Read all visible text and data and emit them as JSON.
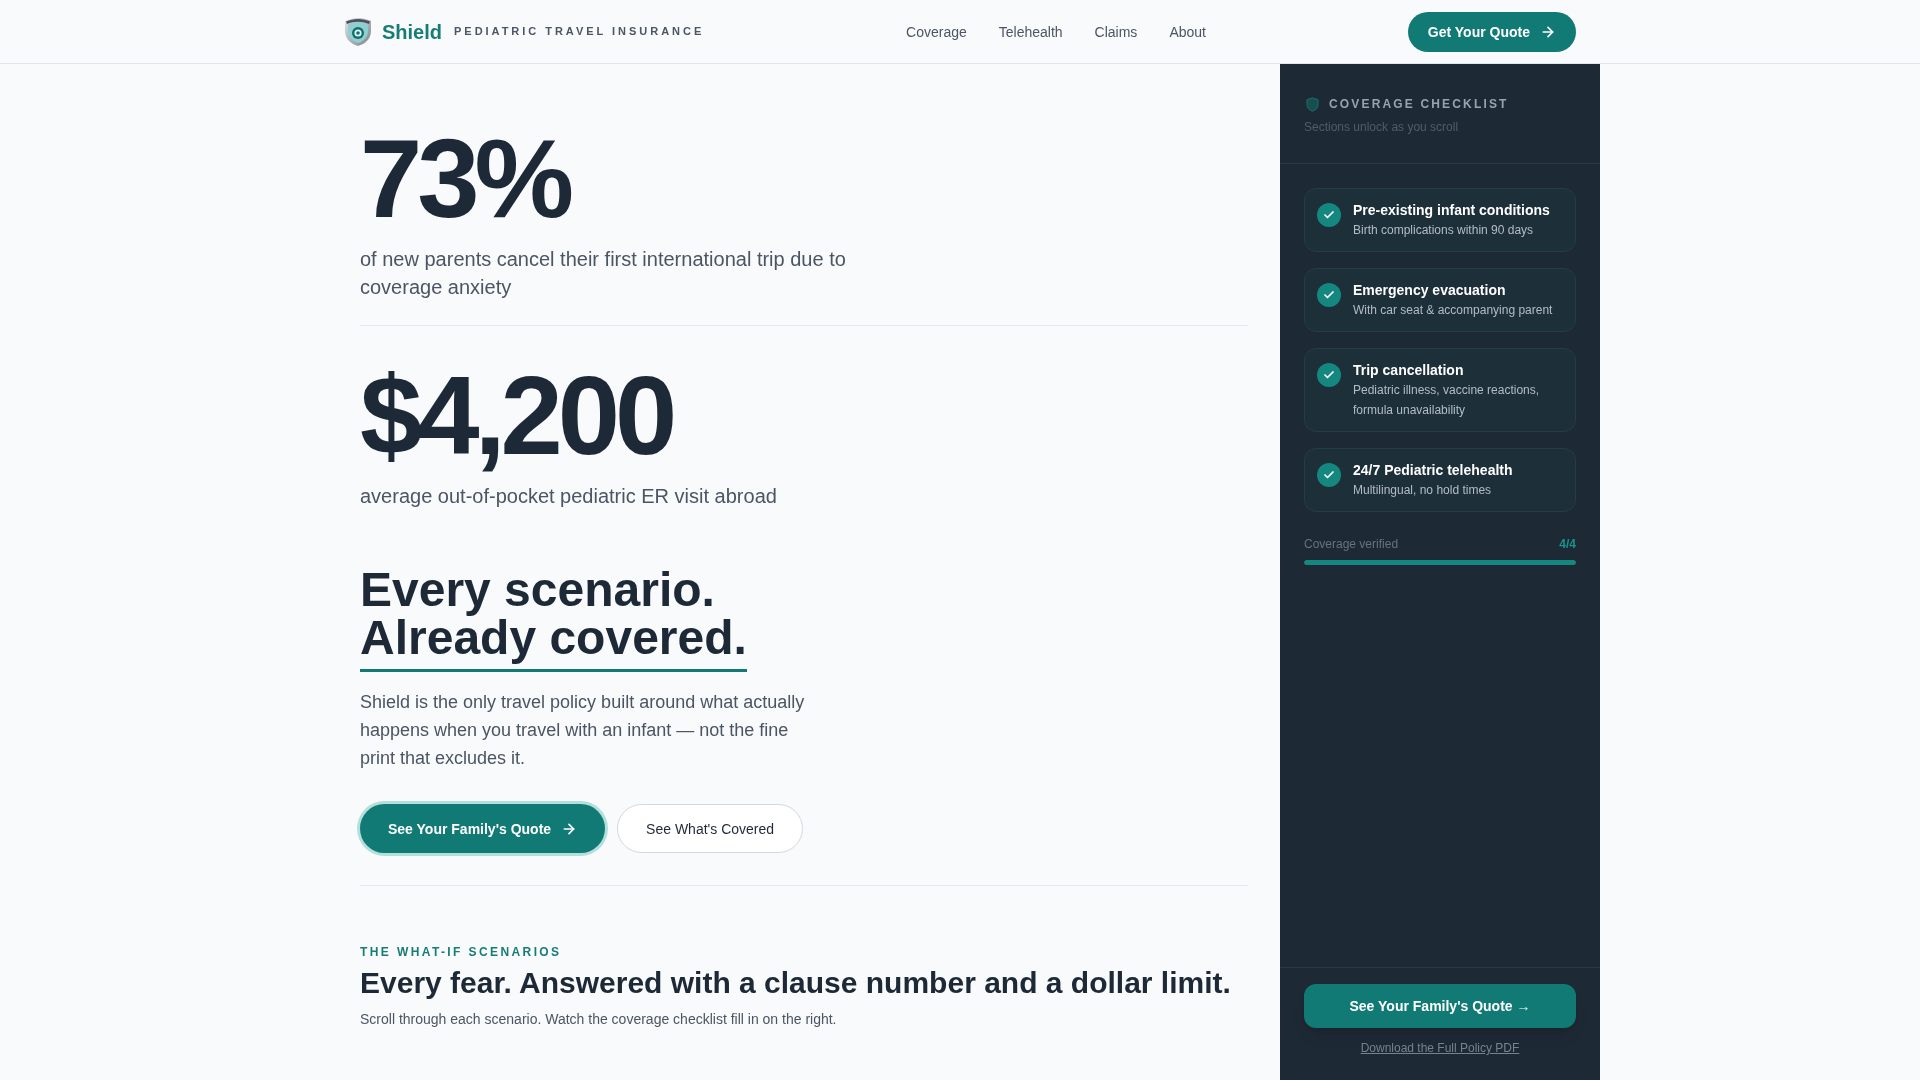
{
  "header": {
    "brand": "Shield",
    "tagline": "PEDIATRIC TRAVEL INSURANCE",
    "nav": [
      "Coverage",
      "Telehealth",
      "Claims",
      "About"
    ],
    "cta": "Get Your Quote"
  },
  "stats": [
    {
      "value": "73%",
      "caption": "of new parents cancel their first international trip due to coverage anxiety"
    },
    {
      "value": "$4,200",
      "caption": "average out-of-pocket pediatric ER visit abroad"
    }
  ],
  "hero": {
    "headline": [
      {
        "text": "Every scenario.",
        "underlined": false
      },
      {
        "text": "Already covered.",
        "underlined": true
      }
    ],
    "body": "Shield is the only travel policy built around what actually happens when you travel with an infant — not the fine print that excludes it.",
    "buttons": [
      {
        "label": "See Your Family's Quote",
        "kind": "primary"
      },
      {
        "label": "See What's Covered",
        "kind": "secondary"
      }
    ]
  },
  "scenarios": {
    "eyebrow": "THE WHAT-IF SCENARIOS",
    "title": "Every fear. Answered with a clause number and a dollar limit.",
    "subtitle": "Scroll through each scenario. Watch the coverage checklist fill in on the right."
  },
  "sidebar": {
    "title": "COVERAGE CHECKLIST",
    "subtitle": "Sections unlock as you scroll",
    "items": [
      {
        "title": "Pre-existing infant conditions",
        "detail": "Birth complications within 90 days",
        "checked": true
      },
      {
        "title": "Emergency evacuation",
        "detail": "With car seat & accompanying parent",
        "checked": true
      },
      {
        "title": "Trip cancellation",
        "detail": "Pediatric illness, vaccine reactions, formula unavailability",
        "checked": true
      },
      {
        "title": "24/7 Pediatric telehealth",
        "detail": "Multilingual, no hold times",
        "checked": true
      }
    ],
    "progress": {
      "label": "Coverage verified",
      "count": "4/4",
      "level": 1
    },
    "cta": "See Your Family's Quote →",
    "link": "Download the Full Policy PDF"
  }
}
